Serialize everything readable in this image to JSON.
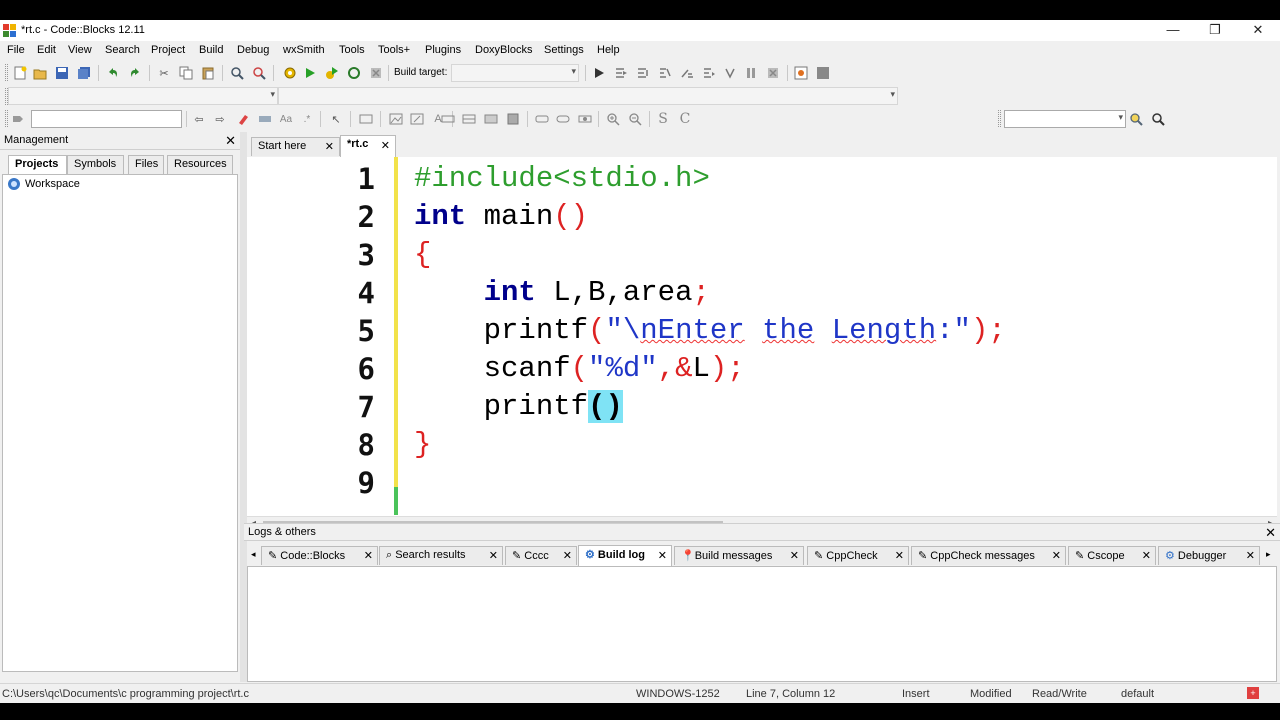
{
  "window": {
    "title": "*rt.c - Code::Blocks 12.11",
    "minimize": "—",
    "maximize": "❐",
    "close": "✕"
  },
  "menu": [
    "File",
    "Edit",
    "View",
    "Search",
    "Project",
    "Build",
    "Debug",
    "wxSmith",
    "Tools",
    "Tools+",
    "Plugins",
    "DoxyBlocks",
    "Settings",
    "Help"
  ],
  "toolbar": {
    "build_target_label": "Build target:"
  },
  "management": {
    "title": "Management",
    "tabs": [
      "Projects",
      "Symbols",
      "Files",
      "Resources"
    ],
    "active_tab": "Projects",
    "tree": [
      "Workspace"
    ]
  },
  "editor": {
    "tabs": [
      {
        "label": "Start here",
        "active": false
      },
      {
        "label": "*rt.c",
        "active": true
      }
    ],
    "line_numbers": [
      "1",
      "2",
      "3",
      "4",
      "5",
      "6",
      "7",
      "8",
      "9"
    ],
    "code": {
      "l1": "#include<stdio.h>",
      "l2_kw": "int",
      "l2_rest": " main",
      "l2_paren": "()",
      "l3": "{",
      "l4_indent": "    ",
      "l4_kw": "int",
      "l4_rest": " L,B,area",
      "l4_semi": ";",
      "l5_indent": "    ",
      "l5_fn": "printf",
      "l5_open": "(",
      "l5_str_a": "\"\\",
      "l5_str_b": "nEnter",
      "l5_str_c": " ",
      "l5_str_d": "the",
      "l5_str_e": " ",
      "l5_str_f": "Length",
      "l5_str_g": ":\"",
      "l5_close": ");",
      "l6_indent": "    ",
      "l6_fn": "scanf",
      "l6_open": "(",
      "l6_str": "\"%d\"",
      "l6_mid": ",&",
      "l6_var": "L",
      "l6_close": ");",
      "l7_indent": "    ",
      "l7_fn": "printf",
      "l7_brace": "()",
      "l8": "}",
      "l9": ""
    }
  },
  "logs": {
    "title": "Logs & others",
    "tabs": [
      "Code::Blocks",
      "Search results",
      "Cccc",
      "Build log",
      "Build messages",
      "CppCheck",
      "CppCheck messages",
      "Cscope",
      "Debugger"
    ],
    "active_tab": "Build log"
  },
  "status": {
    "path": "C:\\Users\\qc\\Documents\\c programming project\\rt.c",
    "encoding": "WINDOWS-1252",
    "position": "Line 7, Column 12",
    "mode": "Insert",
    "modified": "Modified",
    "access": "Read/Write",
    "lang": "default"
  },
  "colors": {
    "keyword": "#00008b",
    "preprocessor": "#2e9e2e",
    "string": "#1f36c7",
    "operator": "#dd2222",
    "brace_highlight": "#7fe3f5",
    "changed_line": "#f2e24a",
    "saved_line": "#4ac35a"
  }
}
